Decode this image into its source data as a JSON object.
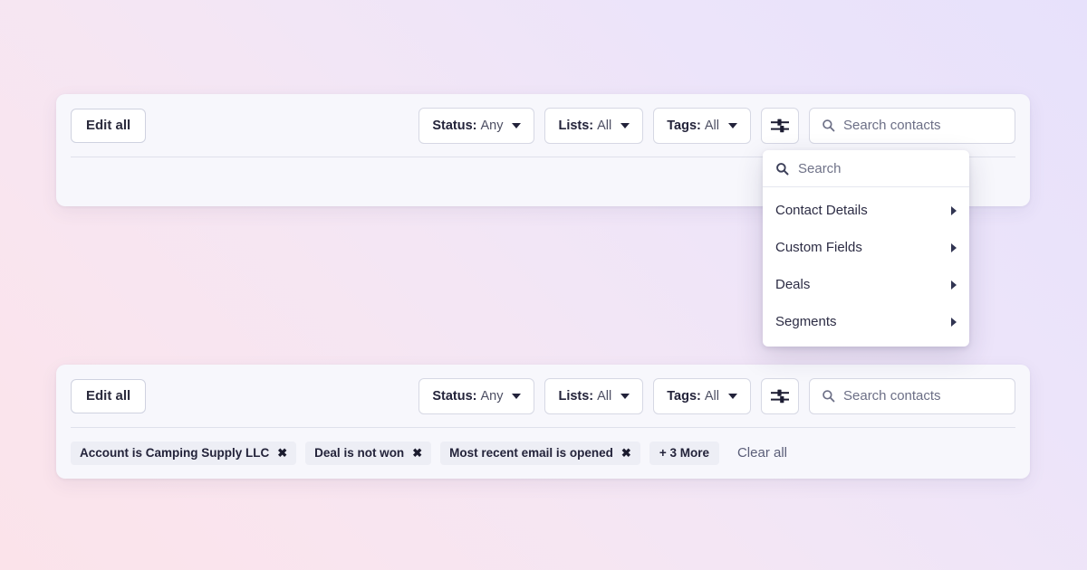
{
  "background": {
    "gradient_from": "#fbe3ea",
    "gradient_to": "#e7e1fb"
  },
  "card_top": {
    "edit_all_label": "Edit all",
    "filters": [
      {
        "key": "Status:",
        "value": "Any",
        "icon": "chevron-down-icon"
      },
      {
        "key": "Lists:",
        "value": "All",
        "icon": "chevron-down-icon"
      },
      {
        "key": "Tags:",
        "value": "All",
        "icon": "chevron-down-icon"
      }
    ],
    "sliders_icon": "sliders-icon",
    "search": {
      "icon": "search-icon",
      "placeholder": "Search contacts",
      "value": ""
    }
  },
  "dropdown": {
    "search": {
      "icon": "search-icon",
      "placeholder": "Search",
      "value": ""
    },
    "items": [
      {
        "label": "Contact Details",
        "icon": "chevron-right-icon"
      },
      {
        "label": "Custom Fields",
        "icon": "chevron-right-icon"
      },
      {
        "label": "Deals",
        "icon": "chevron-right-icon"
      },
      {
        "label": "Segments",
        "icon": "chevron-right-icon"
      }
    ]
  },
  "card_bottom": {
    "edit_all_label": "Edit all",
    "filters": [
      {
        "key": "Status:",
        "value": "Any",
        "icon": "chevron-down-icon"
      },
      {
        "key": "Lists:",
        "value": "All",
        "icon": "chevron-down-icon"
      },
      {
        "key": "Tags:",
        "value": "All",
        "icon": "chevron-down-icon"
      }
    ],
    "sliders_icon": "sliders-icon",
    "search": {
      "icon": "search-icon",
      "placeholder": "Search contacts",
      "value": ""
    },
    "chips": [
      {
        "label": "Account is Camping Supply LLC",
        "remove": "✖"
      },
      {
        "label": "Deal is not won",
        "remove": "✖"
      },
      {
        "label": "Most recent email is opened",
        "remove": "✖"
      }
    ],
    "more_label": "+ 3 More",
    "clear_all_label": "Clear all"
  }
}
